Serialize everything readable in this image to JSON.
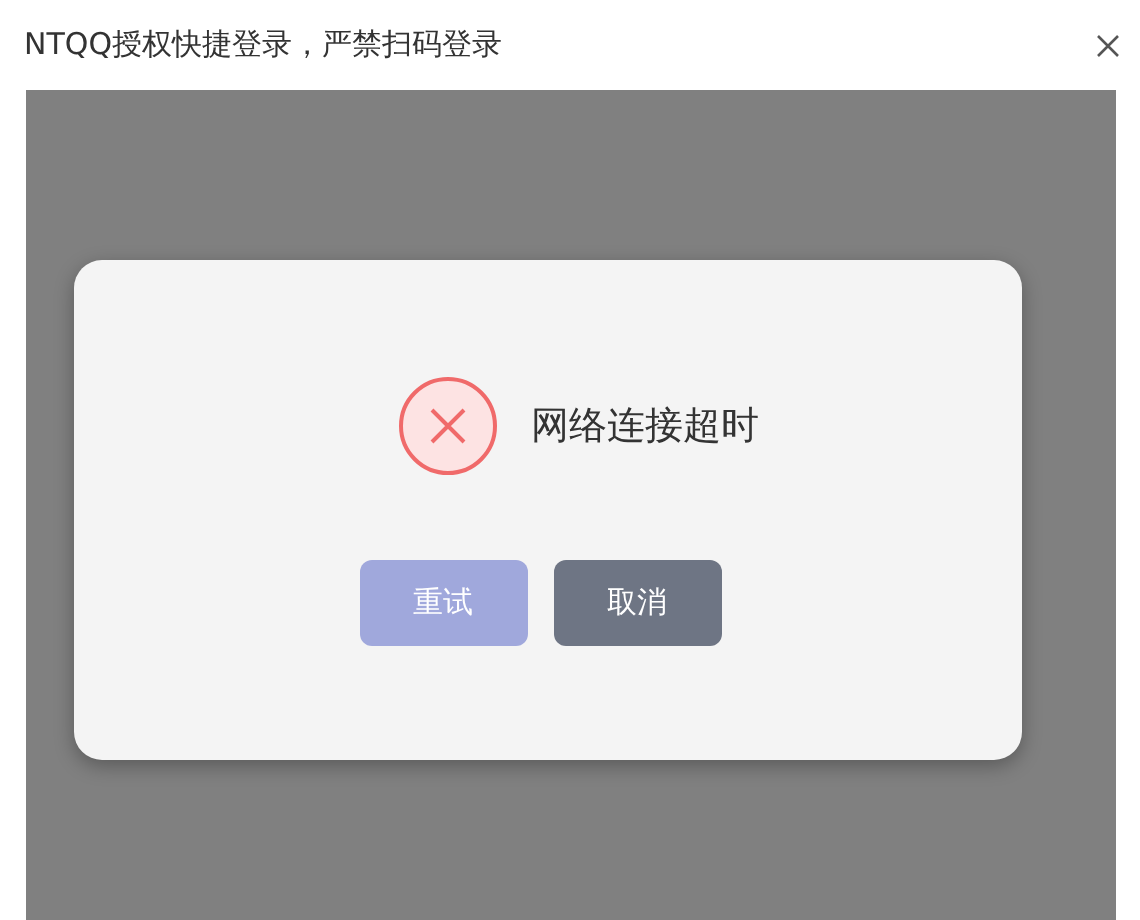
{
  "window": {
    "title": "NTQQ授权快捷登录，严禁扫码登录"
  },
  "dialog": {
    "kind": "error",
    "message": "网络连接超时",
    "buttons": [
      {
        "label": "重试",
        "kind": "primary"
      },
      {
        "label": "取消",
        "kind": "secondary"
      }
    ]
  }
}
